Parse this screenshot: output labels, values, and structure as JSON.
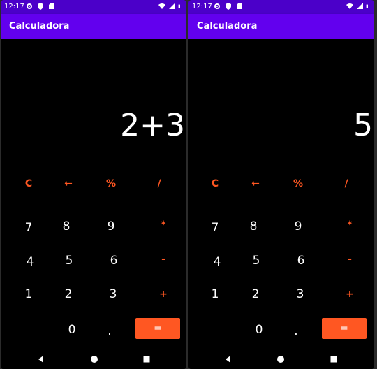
{
  "status_bar": {
    "time": "12:17"
  },
  "app_title": "Calculadora",
  "screens": [
    {
      "display": "2+3"
    },
    {
      "display": "5"
    }
  ],
  "keys": {
    "clear": "C",
    "backspace": "←",
    "percent": "%",
    "divide": "/",
    "multiply": "*",
    "subtract": "-",
    "add": "+",
    "equals": "=",
    "dot": ".",
    "n0": "0",
    "n1": "1",
    "n2": "2",
    "n3": "3",
    "n4": "4",
    "n5": "5",
    "n6": "6",
    "n7": "7",
    "n8": "8",
    "n9": "9"
  },
  "colors": {
    "app_bar": "#6200ee",
    "status_bar": "#4b00c9",
    "accent": "#ff5722",
    "background": "#000000"
  },
  "icons": [
    "settings-icon",
    "shield-icon",
    "sd-card-icon",
    "wifi-icon",
    "signal-icon",
    "battery-icon",
    "back-icon",
    "home-icon",
    "recents-icon"
  ]
}
